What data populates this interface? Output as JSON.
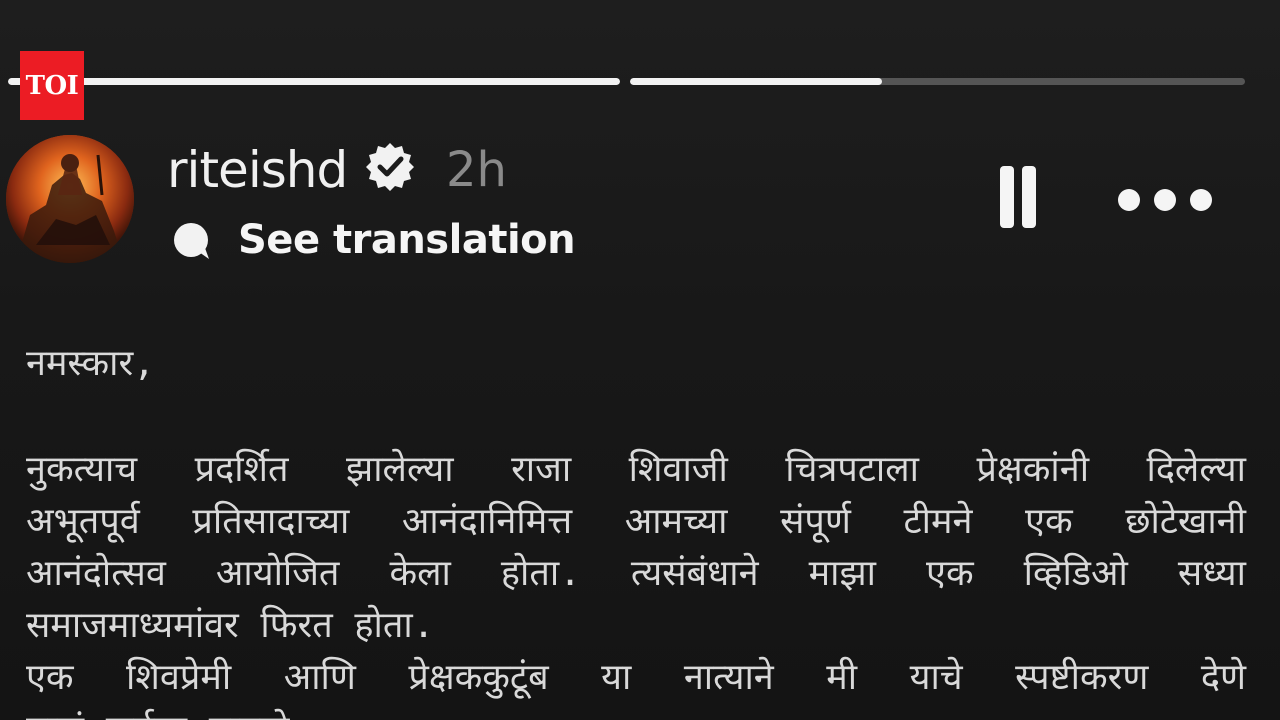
{
  "watermark": {
    "label": "TOI",
    "color": "#ec1c24"
  },
  "story_progress": [
    {
      "segment": 1,
      "progress": 1.0
    },
    {
      "segment": 2,
      "progress": 0.41
    }
  ],
  "header": {
    "username": "riteishd",
    "verified_icon": "verified-badge-icon",
    "time_ago": "2h",
    "translate_icon": "speech-bubble-icon",
    "see_translation_label": "See translation",
    "pause_icon": "pause-icon",
    "more_icon": "more-horizontal-icon"
  },
  "letter": {
    "greeting": "नमस्कार,",
    "lines": [
      "नुकत्याच प्रदर्शित झालेल्या राजा शिवाजी चित्रपटाला प्रेक्षकांनी दिलेल्या",
      "अभूतपूर्व प्रतिसादाच्या आनंदानिमित्त आमच्या संपूर्ण टीमने एक छोटेखानी",
      "आनंदोत्सव आयोजित केला होता. त्यसंबंधाने माझा एक व्हिडिओ सध्या",
      "समाजमाध्यमांवर फिरत होता.",
      "एक शिवप्रेमी आणि प्रेक्षककुटूंब या नात्याने मी याचे स्पष्टीकरण देणे",
      "माझं कर्तव्य मानतो."
    ]
  }
}
